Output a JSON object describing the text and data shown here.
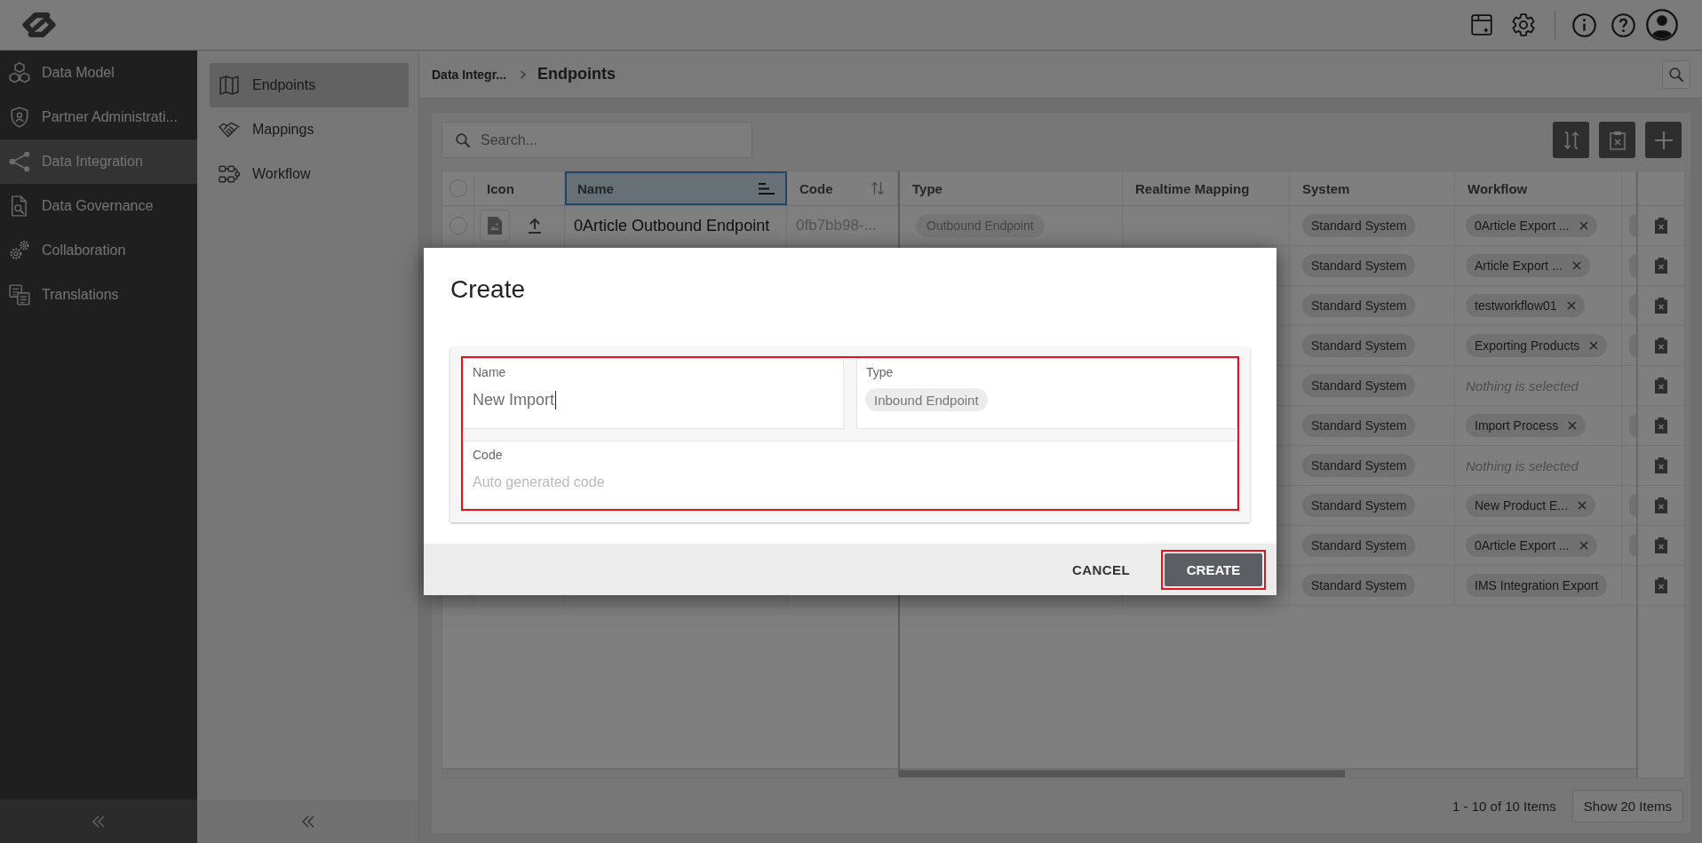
{
  "sidebar": {
    "items": [
      {
        "label": "Data Model",
        "selected": false
      },
      {
        "label": "Partner Administrati...",
        "selected": false
      },
      {
        "label": "Data Integration",
        "selected": true
      },
      {
        "label": "Data Governance",
        "selected": false
      },
      {
        "label": "Collaboration",
        "selected": false
      },
      {
        "label": "Translations",
        "selected": false
      }
    ]
  },
  "subnav": {
    "items": [
      {
        "label": "Endpoints",
        "selected": true
      },
      {
        "label": "Mappings",
        "selected": false
      },
      {
        "label": "Workflow",
        "selected": false
      }
    ]
  },
  "breadcrumb": [
    "Data Integr...",
    "Endpoints"
  ],
  "search": {
    "placeholder": "Search..."
  },
  "table": {
    "all_checked": false,
    "columns": [
      {
        "kind": "plain",
        "label": "Icon",
        "selected": false
      },
      {
        "kind": "sorted",
        "label": "Name",
        "selected": true
      },
      {
        "kind": "sortable",
        "label": "Code",
        "selected": false
      },
      {
        "kind": "plain",
        "label": "Type",
        "selected": false
      },
      {
        "kind": "plain",
        "label": "Realtime Mapping",
        "selected": false
      },
      {
        "kind": "plain",
        "label": "System",
        "selected": false
      },
      {
        "kind": "plain",
        "label": "Workflow",
        "selected": false
      }
    ],
    "rows": [
      {
        "kind": "outbound_endpoint",
        "checked": false,
        "name": "0Article Outbound Endpoint",
        "code": "0fb7bb98-...",
        "type": "Outbound Endpoint",
        "system": "Standard System",
        "workflow": {
          "kind": "chip",
          "label": "0Article Export ...",
          "removable": true
        },
        "column_9_chip": true
      },
      {
        "kind": "endpoint",
        "system": "Standard System",
        "workflow": {
          "kind": "chip",
          "label": "Article Export ...",
          "removable": true
        },
        "column_9_chip": true
      },
      {
        "kind": "endpoint",
        "system": "Standard System",
        "workflow": {
          "kind": "chip",
          "label": "testworkflow01",
          "removable": true
        },
        "column_9_chip": true
      },
      {
        "kind": "endpoint",
        "system": "Standard System",
        "workflow": {
          "kind": "chip",
          "label": "Exporting Products",
          "removable": true
        },
        "column_9_chip": true
      },
      {
        "kind": "endpoint",
        "system": "Standard System",
        "workflow": {
          "kind": "placeholder",
          "label": "Nothing is selected"
        },
        "column_9_chip": false
      },
      {
        "kind": "endpoint",
        "system": "Standard System",
        "workflow": {
          "kind": "chip",
          "label": "Import Process",
          "removable": true
        },
        "column_9_chip": true
      },
      {
        "kind": "endpoint",
        "system": "Standard System",
        "workflow": {
          "kind": "placeholder",
          "label": "Nothing is selected"
        },
        "column_9_chip": false
      },
      {
        "kind": "endpoint",
        "system": "Standard System",
        "workflow": {
          "kind": "chip",
          "label": "New Product E...",
          "removable": true
        },
        "column_9_chip": true
      },
      {
        "kind": "endpoint",
        "system": "Standard System",
        "workflow": {
          "kind": "chip",
          "label": "0Article Export ...",
          "removable": true
        },
        "column_9_chip": true
      },
      {
        "kind": "endpoint",
        "system": "Standard System",
        "workflow": {
          "kind": "chip",
          "label": "IMS Integration Export",
          "removable": false
        },
        "column_9_chip": false
      }
    ]
  },
  "pagination": {
    "summary": "1 - 10 of 10 Items",
    "button": "Show 20 Items"
  },
  "dialog": {
    "title": "Create",
    "form": {
      "highlighted": true,
      "fields": [
        {
          "kind": "text",
          "label": "Name",
          "value": "New Import",
          "focused": true
        },
        {
          "kind": "chips",
          "label": "Type",
          "chips": [
            "Inbound Endpoint"
          ],
          "focused": false
        },
        {
          "kind": "text",
          "label": "Code",
          "placeholder": "Auto generated code",
          "focused": false
        }
      ]
    },
    "buttons": [
      {
        "kind": "flat",
        "label": "CANCEL",
        "highlighted": false
      },
      {
        "kind": "raised",
        "label": "CREATE",
        "highlighted": true
      }
    ]
  }
}
